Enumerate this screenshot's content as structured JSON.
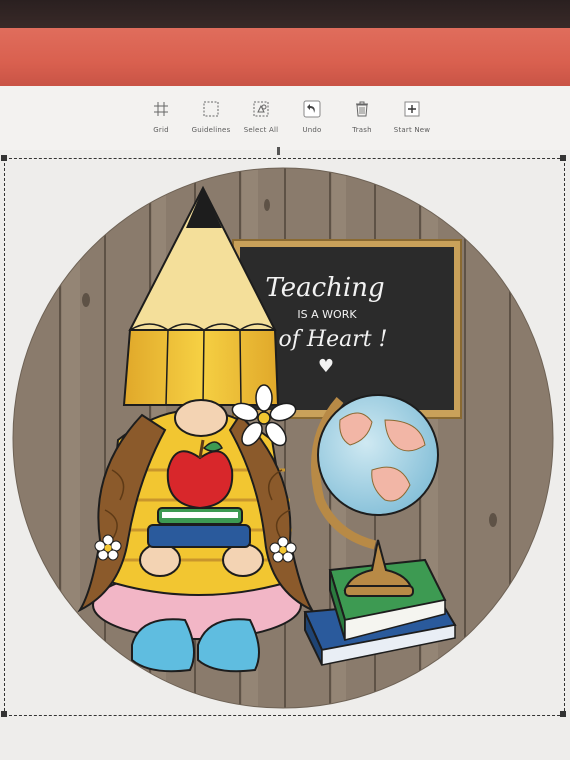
{
  "toolbar": {
    "items": [
      {
        "label": "Grid",
        "icon": "grid-icon"
      },
      {
        "label": "Guidelines",
        "icon": "guidelines-icon"
      },
      {
        "label": "Select All",
        "icon": "select-all-icon"
      },
      {
        "label": "Undo",
        "icon": "undo-icon"
      },
      {
        "label": "Trash",
        "icon": "trash-icon"
      },
      {
        "label": "Start New",
        "icon": "plus-icon"
      }
    ]
  },
  "design": {
    "chalkboard_line1": "Teaching",
    "chalkboard_line2": "IS A WORK",
    "chalkboard_line3": "of Heart !",
    "chalkboard_heart": "♥"
  },
  "colors": {
    "topbar": "#d9604f",
    "toolbar_bg": "#f3f2f0",
    "wood": "#8a7a6a",
    "pencil_yellow": "#f2c631",
    "chalkboard": "#2b2b2b",
    "chalkboard_frame": "#c9a15a"
  }
}
